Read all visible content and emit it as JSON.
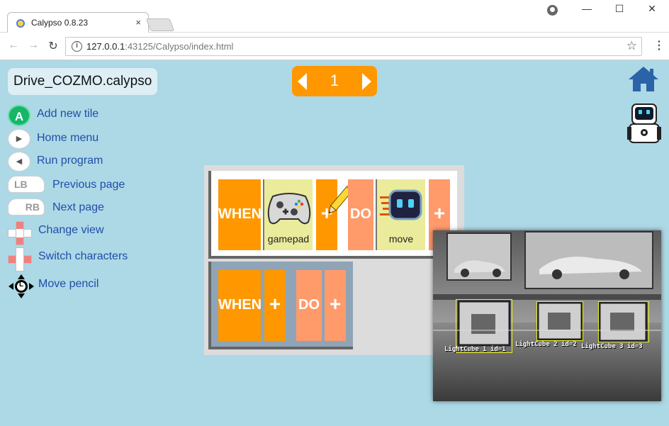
{
  "browser": {
    "tab_title": "Calypso 0.8.23",
    "tab_close": "×",
    "url_host": "127.0.0.1",
    "url_rest": ":43125/Calypso/index.html",
    "window_controls": {
      "minimize": "—",
      "maximize": "☐",
      "close": "✕"
    },
    "nav": {
      "back": "←",
      "forward": "→",
      "reload": "↻"
    },
    "info": "i",
    "star": "☆",
    "menu": "⋮"
  },
  "app": {
    "filename": "Drive_COZMO.calypso",
    "page_number": "1",
    "controls": [
      {
        "key": "A",
        "label": "Add new tile",
        "icon": "a-button-icon"
      },
      {
        "key": "▶",
        "label": "Home menu",
        "icon": "start-button-icon"
      },
      {
        "key": "◀",
        "label": "Run program",
        "icon": "back-button-icon"
      },
      {
        "key": "LB",
        "label": "Previous page",
        "icon": "left-bumper-icon"
      },
      {
        "key": "RB",
        "label": "Next page",
        "icon": "right-bumper-icon"
      },
      {
        "key": "",
        "label": "Change view",
        "icon": "dpad-up-icon"
      },
      {
        "key": "",
        "label": "Switch characters",
        "icon": "dpad-left-icon"
      },
      {
        "key": "L",
        "label": "Move pencil",
        "icon": "left-stick-icon"
      }
    ],
    "rules": [
      {
        "when": "WHEN",
        "card": "gamepad",
        "plus": "+",
        "do": "DO",
        "action": "move"
      },
      {
        "when": "WHEN",
        "plus": "+",
        "do": "DO"
      }
    ],
    "camera": {
      "cubes": [
        {
          "label": "LightCube 1 id=1"
        },
        {
          "label": "LightCube 2 id=2"
        },
        {
          "label": "LightCube 3 id=3"
        }
      ]
    },
    "colors": {
      "background": "#add8e6",
      "when": "#ff9800",
      "do": "#ff9a6b",
      "card": "#eaec9c",
      "label": "#1f4fa8"
    }
  }
}
